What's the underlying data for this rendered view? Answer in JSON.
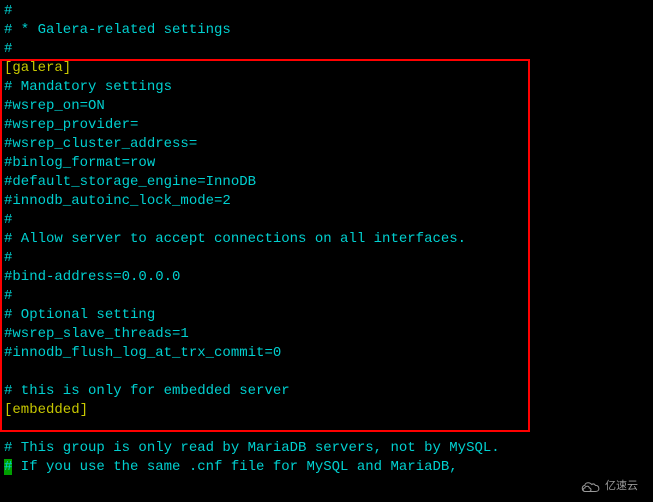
{
  "terminal": {
    "lines": [
      {
        "text": "#",
        "class": "cyan"
      },
      {
        "text": "# * Galera-related settings",
        "class": "cyan"
      },
      {
        "text": "#",
        "class": "cyan"
      },
      {
        "text": "[galera]",
        "class": "yellow"
      },
      {
        "text": "# Mandatory settings",
        "class": "cyan"
      },
      {
        "text": "#wsrep_on=ON",
        "class": "cyan"
      },
      {
        "text": "#wsrep_provider=",
        "class": "cyan"
      },
      {
        "text": "#wsrep_cluster_address=",
        "class": "cyan"
      },
      {
        "text": "#binlog_format=row",
        "class": "cyan"
      },
      {
        "text": "#default_storage_engine=InnoDB",
        "class": "cyan"
      },
      {
        "text": "#innodb_autoinc_lock_mode=2",
        "class": "cyan"
      },
      {
        "text": "#",
        "class": "cyan"
      },
      {
        "text": "# Allow server to accept connections on all interfaces.",
        "class": "cyan"
      },
      {
        "text": "#",
        "class": "cyan"
      },
      {
        "text": "#bind-address=0.0.0.0",
        "class": "cyan"
      },
      {
        "text": "#",
        "class": "cyan"
      },
      {
        "text": "# Optional setting",
        "class": "cyan"
      },
      {
        "text": "#wsrep_slave_threads=1",
        "class": "cyan"
      },
      {
        "text": "#innodb_flush_log_at_trx_commit=0",
        "class": "cyan"
      },
      {
        "text": "",
        "class": "cyan"
      },
      {
        "text": "# this is only for embedded server",
        "class": "cyan"
      },
      {
        "text": "[embedded]",
        "class": "yellow"
      },
      {
        "text": "",
        "class": "cyan"
      },
      {
        "text": "# This group is only read by MariaDB servers, not by MySQL.",
        "class": "cyan"
      }
    ],
    "lastLine": {
      "cursor": "#",
      "text": " If you use the same .cnf file for MySQL and MariaDB,"
    }
  },
  "watermark": {
    "text": "亿速云"
  }
}
